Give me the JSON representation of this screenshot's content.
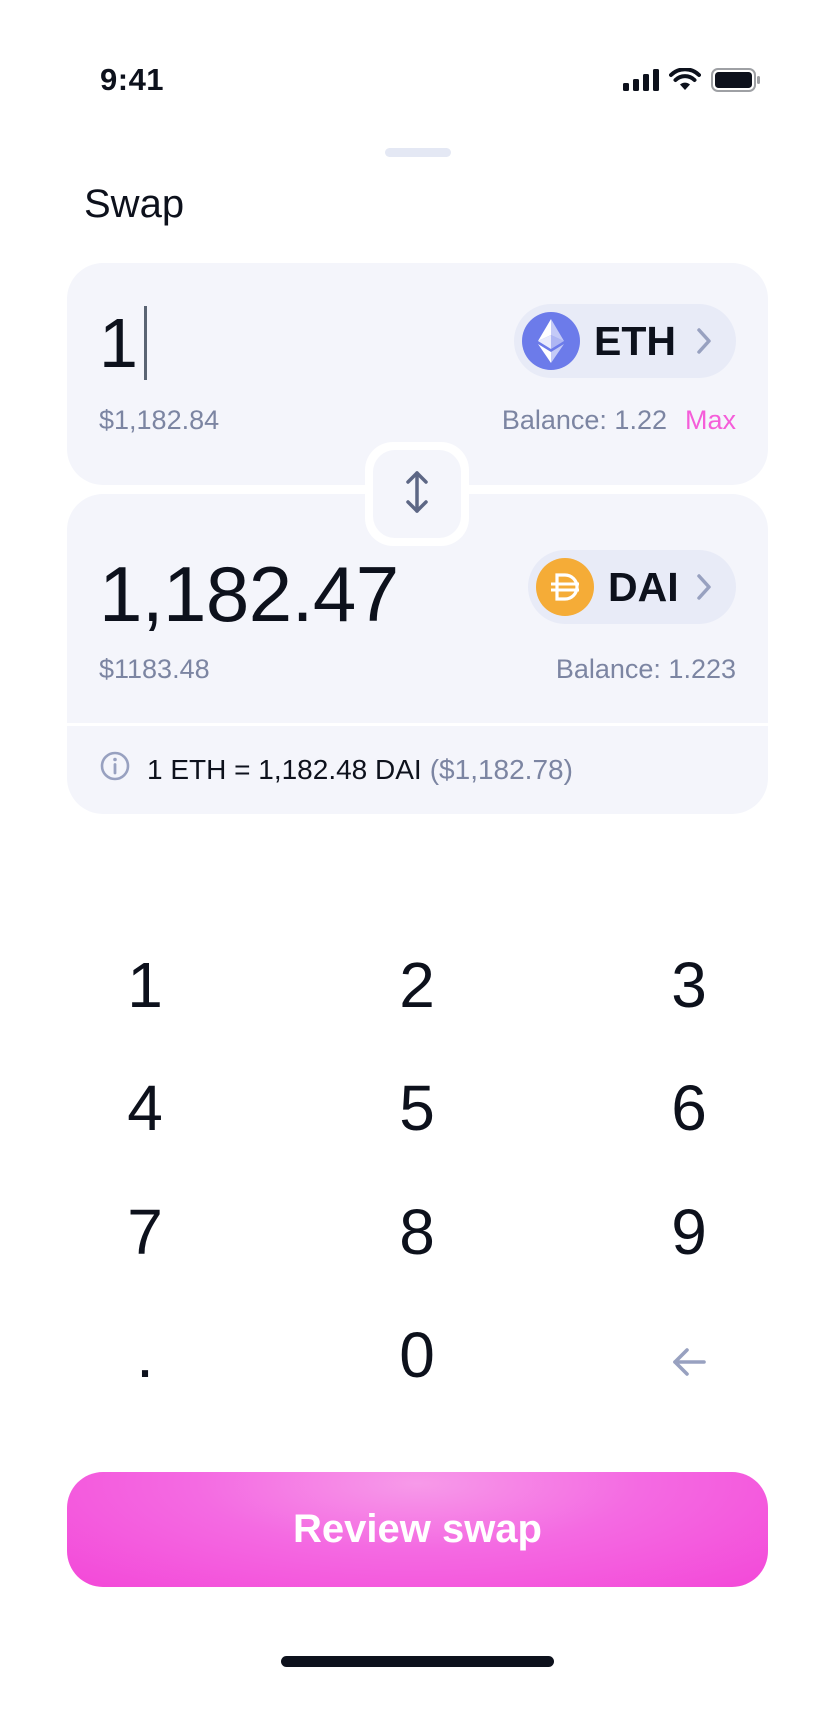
{
  "status_bar": {
    "time": "9:41"
  },
  "sheet": {
    "title": "Swap"
  },
  "from": {
    "amount": "1",
    "usd_value": "$1,182.84",
    "token": {
      "symbol": "ETH",
      "icon": "ethereum-icon",
      "color": "#6c7bea"
    },
    "balance": "Balance: 1.22",
    "max_label": "Max"
  },
  "to": {
    "amount": "1,182.47",
    "usd_value": "$1183.48",
    "token": {
      "symbol": "DAI",
      "icon": "dai-icon",
      "color": "#f5ac37"
    },
    "balance": "Balance: 1.223"
  },
  "rate": {
    "text": "1 ETH = 1,182.48 DAI",
    "usd": "($1,182.78)"
  },
  "keypad": {
    "keys": [
      "1",
      "2",
      "3",
      "4",
      "5",
      "6",
      "7",
      "8",
      "9",
      ".",
      "0"
    ],
    "backspace_icon": "arrow-left-icon"
  },
  "action": {
    "review_label": "Review swap"
  },
  "colors": {
    "accent": "#f55dd9",
    "card_background": "#f4f5fb",
    "secondary_text": "#7c85a2",
    "primary_text": "#0d111c"
  }
}
